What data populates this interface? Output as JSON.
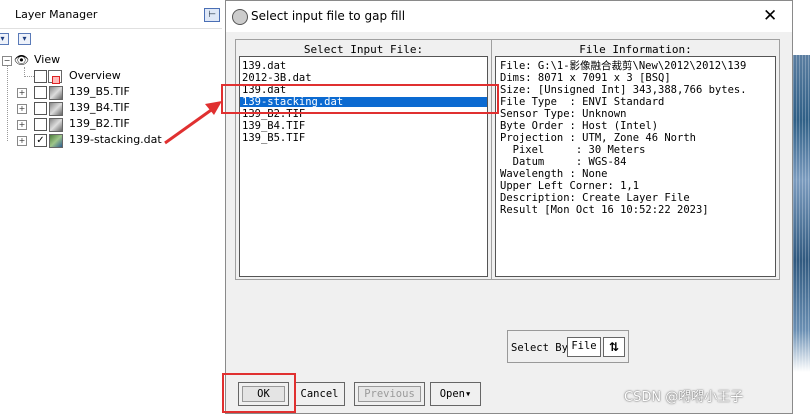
{
  "layer_manager": {
    "title": "Layer Manager",
    "pin_icon": "pin-icon",
    "tree": {
      "root": "View",
      "items": [
        {
          "label": "Overview",
          "checked": null
        },
        {
          "label": "139_B5.TIF",
          "checked": false
        },
        {
          "label": "139_B4.TIF",
          "checked": false
        },
        {
          "label": "139_B2.TIF",
          "checked": false
        },
        {
          "label": "139-stacking.dat",
          "checked": true
        }
      ]
    }
  },
  "dialog": {
    "title": "Select input file to gap fill",
    "close_label": "✕",
    "select_input_header": "Select Input File:",
    "file_info_header": "File Information:",
    "files": [
      {
        "name": "139.dat",
        "selected": false
      },
      {
        "name": "2012-3B.dat",
        "selected": false
      },
      {
        "name": "139.dat",
        "selected": false
      },
      {
        "name": "139-stacking.dat",
        "selected": true
      },
      {
        "name": "139_B2.TIF",
        "selected": false
      },
      {
        "name": "139_B4.TIF",
        "selected": false
      },
      {
        "name": "139_B5.TIF",
        "selected": false
      }
    ],
    "file_info": [
      "File: G:\\1-影像融合裁剪\\New\\2012\\2012\\139",
      "Dims: 8071 x 7091 x 3 [BSQ]",
      "Size: [Unsigned Int] 343,388,766 bytes.",
      "File Type  : ENVI Standard",
      "Sensor Type: Unknown",
      "Byte Order : Host (Intel)",
      "Projection : UTM, Zone 46 North",
      "  Pixel     : 30 Meters",
      "  Datum     : WGS-84",
      "Wavelength : None",
      "Upper Left Corner: 1,1",
      "Description: Create Layer File",
      "Result [Mon Oct 16 10:52:22 2023]"
    ],
    "select_by_label": "Select By",
    "select_by_value": "File",
    "sort_icon": "sort-icon",
    "buttons": {
      "ok": "OK",
      "cancel": "Cancel",
      "previous": "Previous",
      "open": "Open▾"
    }
  },
  "watermark": "CSDN @嘚嘚小王子",
  "colors": {
    "selection": "#0b6ad1",
    "annotation_red": "#e03030"
  }
}
